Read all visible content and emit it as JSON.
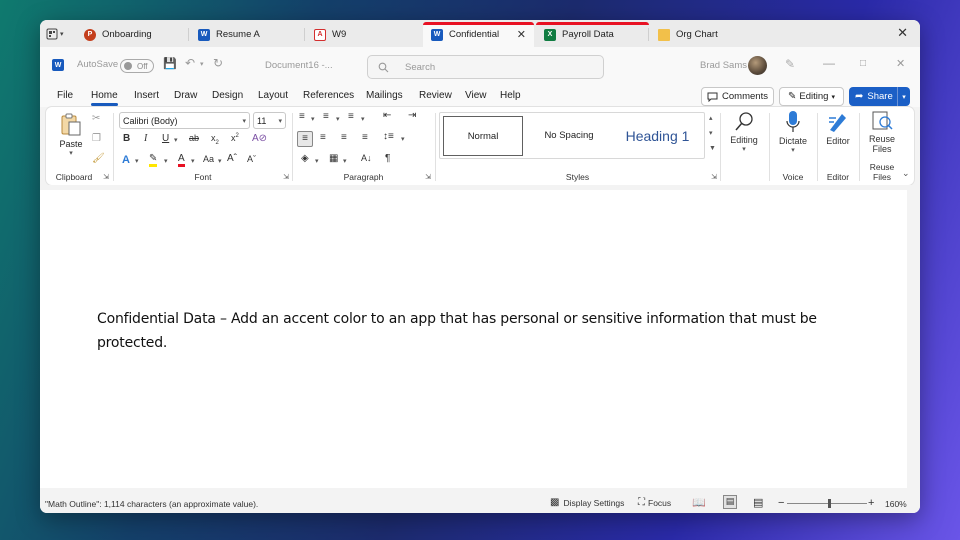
{
  "tabs": [
    {
      "label": "Onboarding",
      "app": "powerpoint",
      "icon_letter": "P",
      "color": "#c43e1c"
    },
    {
      "label": "Resume A",
      "app": "word",
      "icon_letter": "W",
      "color": "#185abd"
    },
    {
      "label": "W9",
      "app": "pdf",
      "icon_letter": "A",
      "color": "#d32f2f"
    },
    {
      "label": "Confidential",
      "app": "word",
      "icon_letter": "W",
      "color": "#185abd",
      "active": true,
      "accent": "#e81123"
    },
    {
      "label": "Payroll Data",
      "app": "excel",
      "icon_letter": "X",
      "color": "#107c41",
      "accent": "#e81123"
    },
    {
      "label": "Org Chart",
      "app": "folder",
      "icon_letter": "",
      "color": "#f2c04a"
    }
  ],
  "titlebar": {
    "autosave_label": "AutoSave",
    "autosave_state": "Off",
    "doc_name": "Document16 -...",
    "search_placeholder": "Search",
    "user_name": "Brad Sams"
  },
  "menu": {
    "items": [
      "File",
      "Home",
      "Insert",
      "Draw",
      "Design",
      "Layout",
      "References",
      "Mailings",
      "Review",
      "View",
      "Help"
    ],
    "active": "Home",
    "comments_label": "Comments",
    "editing_label": "Editing",
    "share_label": "Share"
  },
  "ribbon": {
    "clipboard": {
      "paste_label": "Paste",
      "group_label": "Clipboard"
    },
    "font": {
      "font_name": "Calibri (Body)",
      "font_size": "11",
      "group_label": "Font"
    },
    "paragraph": {
      "group_label": "Paragraph"
    },
    "styles": {
      "items": [
        "Normal",
        "No Spacing",
        "Heading 1"
      ],
      "selected": "Normal",
      "group_label": "Styles"
    },
    "editing": {
      "label": "Editing"
    },
    "voice": {
      "dictate_label": "Dictate",
      "group_label": "Voice"
    },
    "editor": {
      "label": "Editor",
      "group_label": "Editor"
    },
    "reuse": {
      "label_line1": "Reuse",
      "label_line2": "Files",
      "group_label": "Reuse Files"
    }
  },
  "document": {
    "text": "Confidential Data – Add an accent color to an app that has personal or sensitive information that must be protected."
  },
  "statusbar": {
    "outline_info": "\"Math Outline\": 1,114 characters (an approximate value).",
    "display_settings": "Display Settings",
    "focus": "Focus",
    "zoom": "160%",
    "zoom_minus": "−",
    "zoom_plus": "+"
  },
  "colors": {
    "word_blue": "#185abd",
    "accent_red": "#e81123",
    "share_blue": "#1b5fc6"
  }
}
